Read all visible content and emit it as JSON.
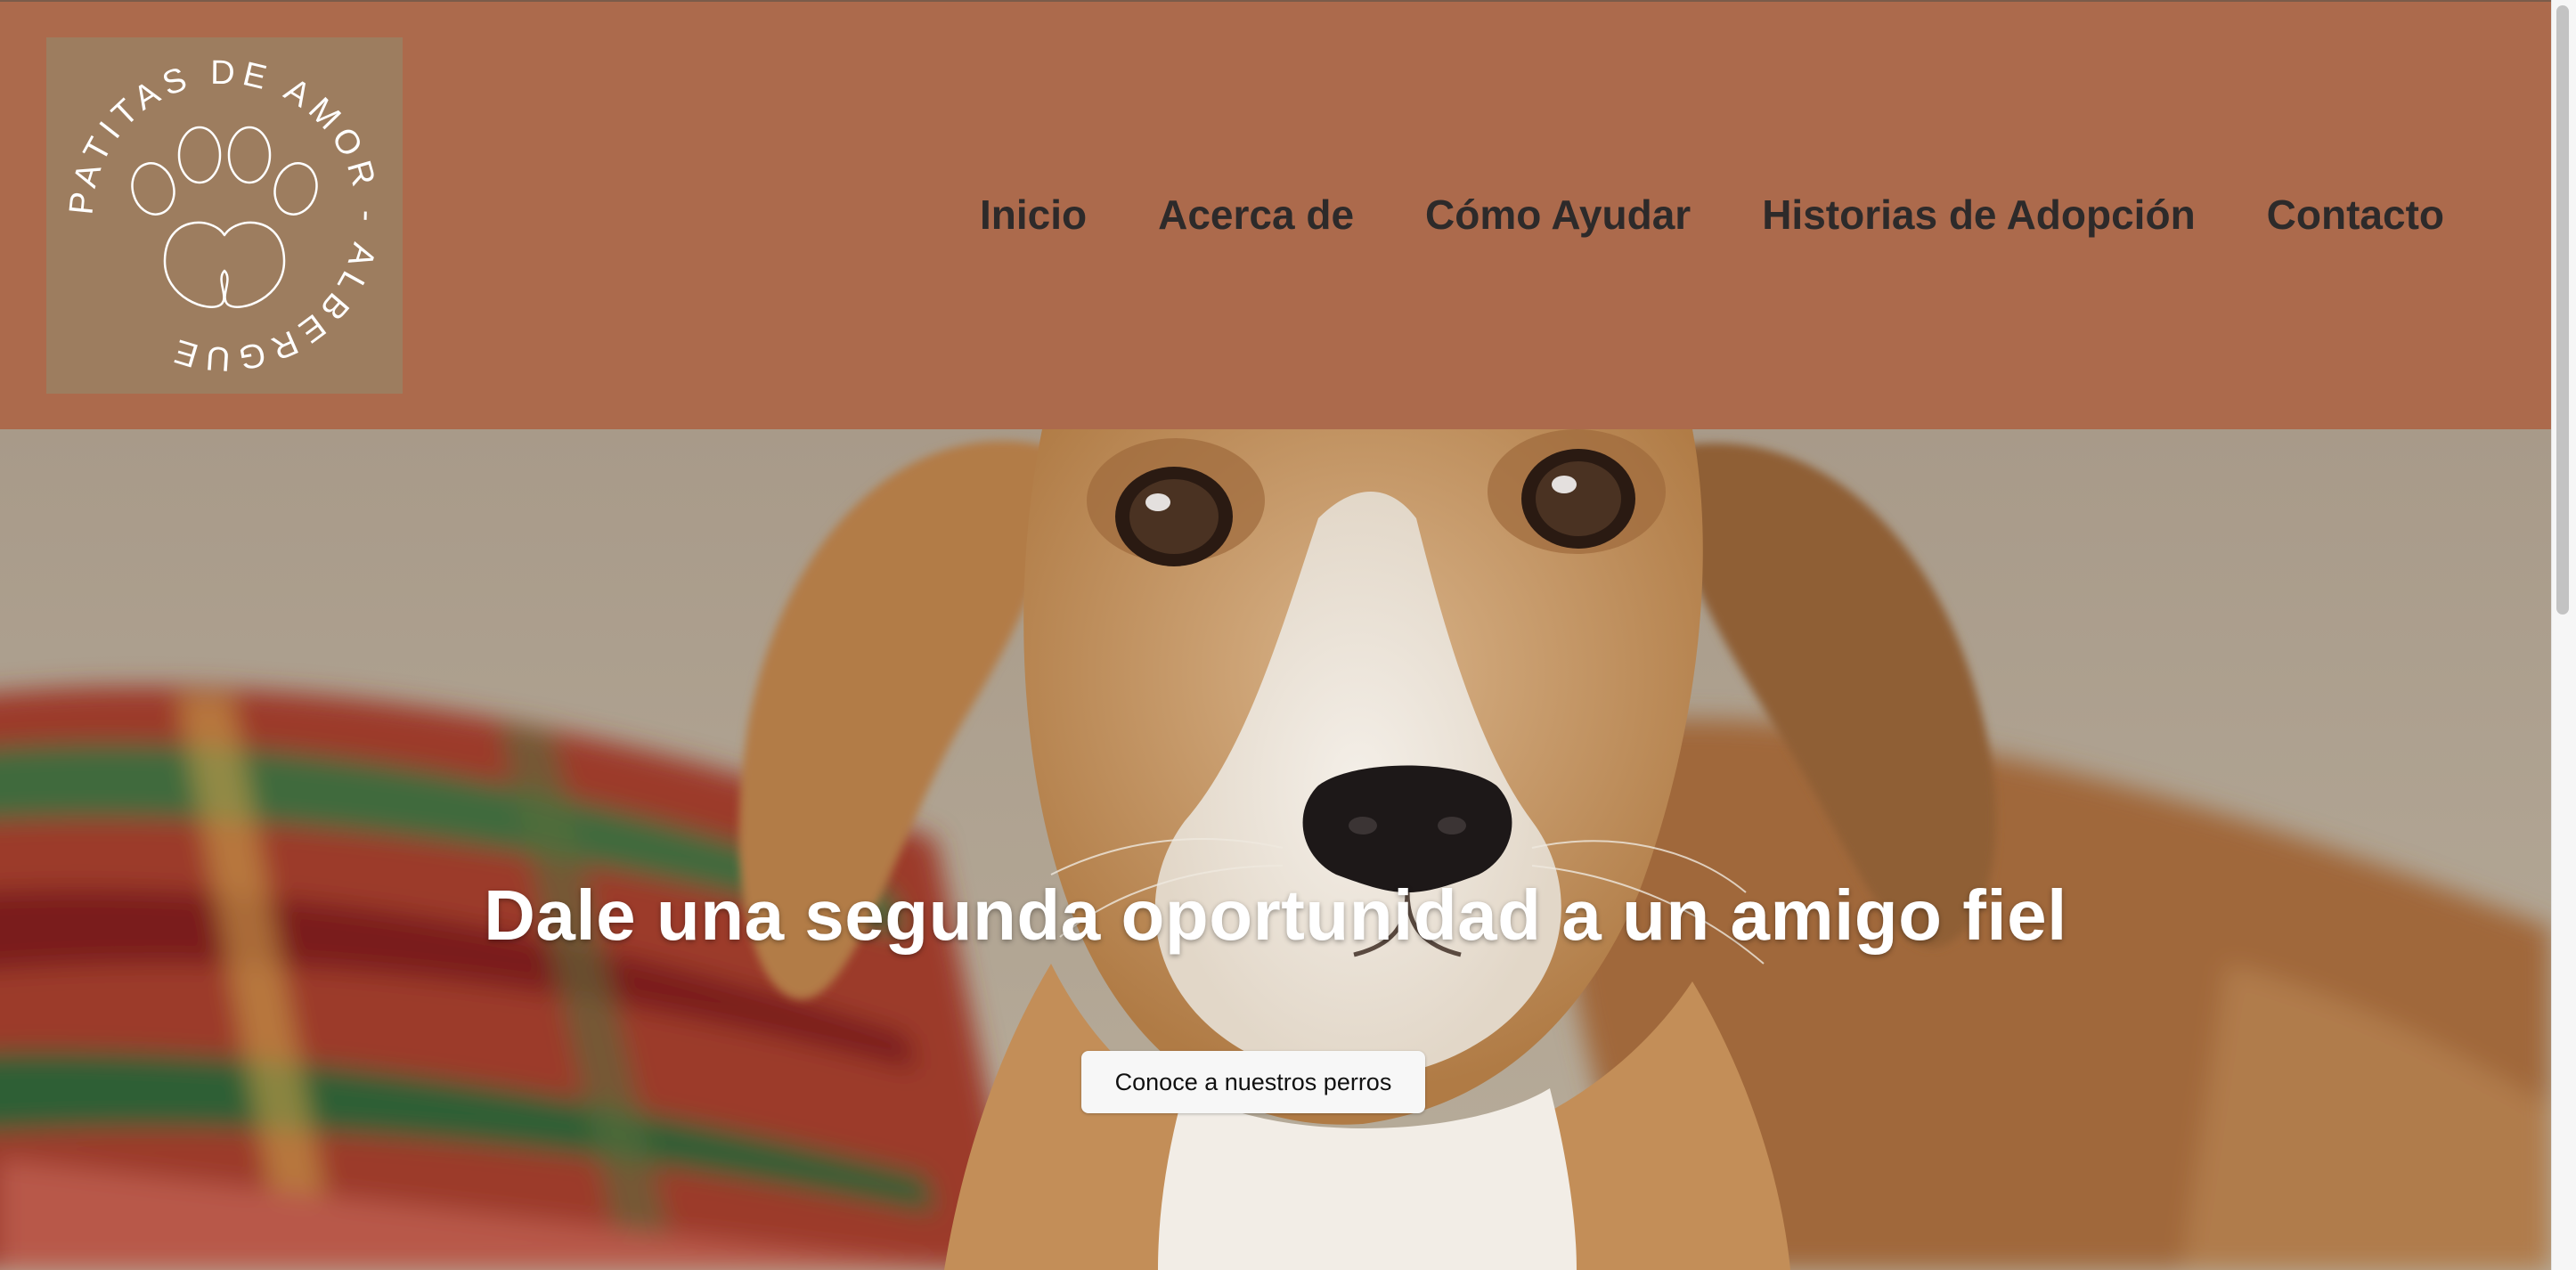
{
  "brand": {
    "logo_ring_text": "PATITAS DE AMOR - ALBERGUE",
    "colors": {
      "header_bg": "#ac6a4c",
      "logo_bg": "#9d7d5f",
      "nav_text": "#2d2a2a"
    }
  },
  "nav": {
    "items": [
      {
        "label": "Inicio"
      },
      {
        "label": "Acerca de"
      },
      {
        "label": "Cómo Ayudar"
      },
      {
        "label": "Historias de Adopción"
      },
      {
        "label": "Contacto"
      }
    ]
  },
  "hero": {
    "title": "Dale una segunda oportunidad a un amigo fiel",
    "cta_label": "Conoce a nuestros perros",
    "image_icon": "dog-photo"
  },
  "icons": {
    "logo_symbol": "paw-heart-icon"
  }
}
